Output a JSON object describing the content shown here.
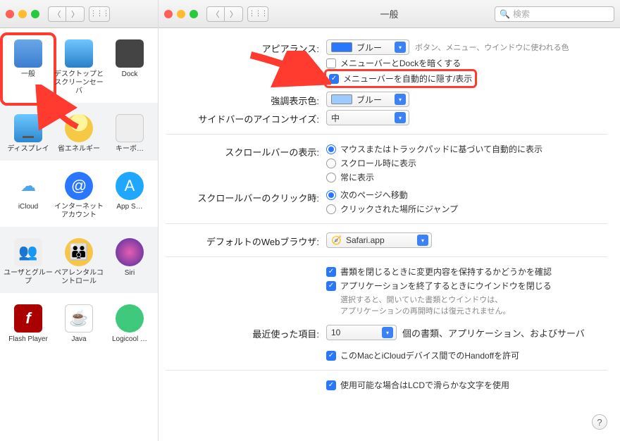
{
  "left": {
    "items": [
      [
        "一般",
        "デスクトップとスクリーンセーバ",
        "Dock"
      ],
      [
        "ディスプレイ",
        "省エネルギー",
        "キーボ…"
      ],
      [
        "iCloud",
        "インターネットアカウント",
        "App S…"
      ],
      [
        "ユーザとグループ",
        "ペアレンタルコントロール",
        "Siri"
      ],
      [
        "Flash Player",
        "Java",
        "Logicool …"
      ]
    ]
  },
  "right": {
    "title": "一般",
    "search_placeholder": "検索",
    "appearance": {
      "label": "アピアランス:",
      "value": "ブルー",
      "note": "ボタン、メニュー、ウインドウに使われる色",
      "chk1": "メニューバーとDockを暗くする",
      "chk2": "メニューバーを自動的に隠す/表示"
    },
    "highlight": {
      "label": "強調表示色:",
      "value": "ブルー"
    },
    "sidebar": {
      "label": "サイドバーのアイコンサイズ:",
      "value": "中"
    },
    "scroll_show": {
      "label": "スクロールバーの表示:",
      "opts": [
        "マウスまたはトラックパッドに基づいて自動的に表示",
        "スクロール時に表示",
        "常に表示"
      ]
    },
    "scroll_click": {
      "label": "スクロールバーのクリック時:",
      "opts": [
        "次のページへ移動",
        "クリックされた場所にジャンプ"
      ]
    },
    "browser": {
      "label": "デフォルトのWebブラウザ:",
      "value": "Safari.app"
    },
    "close_opts": {
      "c1": "書類を閉じるときに変更内容を保持するかどうかを確認",
      "c2": "アプリケーションを終了するときにウインドウを閉じる",
      "note1": "選択すると、開いていた書類とウインドウは、",
      "note2": "アプリケーションの再開時には復元されません。"
    },
    "recent": {
      "label": "最近使った項目:",
      "value": "10",
      "suffix": "個の書類、アプリケーション、およびサーバ"
    },
    "handoff": "このMacとiCloudデバイス間でのHandoffを許可",
    "lcd": "使用可能な場合はLCDで滑らかな文字を使用"
  }
}
